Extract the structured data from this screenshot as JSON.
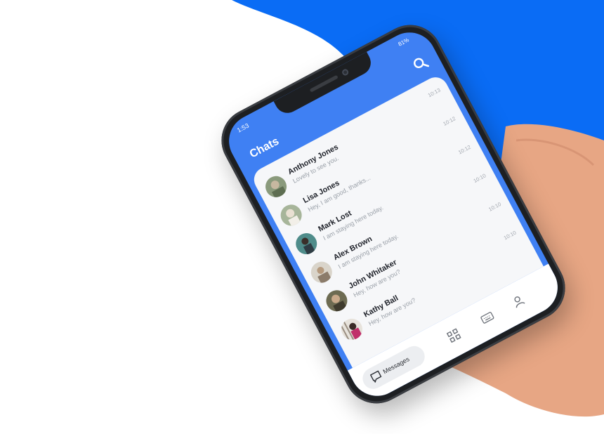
{
  "statusbar": {
    "time": "1:53",
    "battery": "81%"
  },
  "header": {
    "title": "Chats",
    "search_icon": "search-icon"
  },
  "chats": [
    {
      "name": "Anthony Jones",
      "preview": "Lovely to see you.",
      "time": "10:13"
    },
    {
      "name": "Lisa Jones",
      "preview": "Hey, I am good, thanks...",
      "time": "10:12"
    },
    {
      "name": "Mark Lost",
      "preview": "I am staying here today.",
      "time": "10:12"
    },
    {
      "name": "Alex Brown",
      "preview": "I am staying here today.",
      "time": "10:10"
    },
    {
      "name": "John Whitaker",
      "preview": "Hey, how are you?",
      "time": "10:10"
    },
    {
      "name": "Kathy Ball",
      "preview": "Hey, how are you?",
      "time": "10:10"
    }
  ],
  "tabbar": {
    "messages_label": "Messages",
    "icons": [
      "chat-bubble-icon",
      "qr-code-icon",
      "keyboard-icon",
      "user-icon"
    ]
  },
  "colors": {
    "brand_blue": "#0a6cf5",
    "header_blue": "#3f80f3",
    "skin": "#e7a684"
  }
}
